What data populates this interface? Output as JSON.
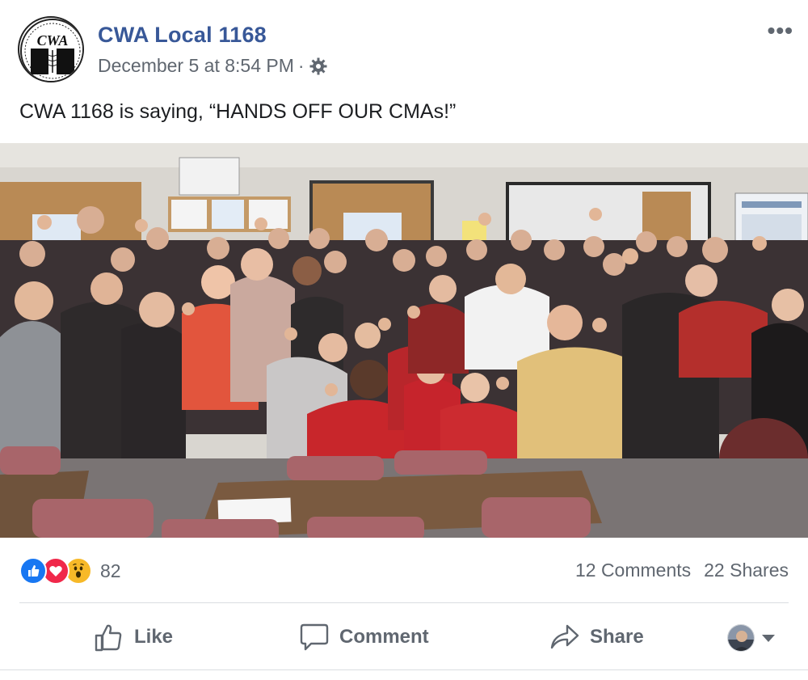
{
  "post": {
    "page_name": "CWA Local 1168",
    "logo_text": "CWA",
    "timestamp": "December 5 at 8:54 PM",
    "separator": "·",
    "privacy_icon": "gear-icon",
    "more_icon": "more-options-icon",
    "more_label": "•••",
    "text": "CWA 1168 is saying, “HANDS OFF OUR CMAs!”"
  },
  "reactions": {
    "icons": [
      "like-reaction-icon",
      "love-reaction-icon",
      "wow-reaction-icon"
    ],
    "count": "82",
    "comments": "12 Comments",
    "shares": "22 Shares"
  },
  "actions": {
    "like_label": "Like",
    "comment_label": "Comment",
    "share_label": "Share"
  },
  "colors": {
    "page_name": "#385898",
    "secondary_text": "#606770",
    "like_blue": "#1877f2",
    "love_red": "#f0284a",
    "wow_yellow": "#f7b928"
  }
}
